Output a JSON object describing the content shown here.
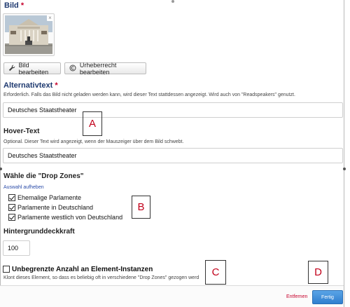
{
  "image_section": {
    "title": "Bild",
    "required_mark": "*",
    "remove_glyph": "×",
    "edit_button": "Bild bearbeiten",
    "copyright_button": "Urheberrecht bearbeiten"
  },
  "alt_text": {
    "title": "Alternativtext",
    "required_mark": "*",
    "help": "Erforderlich. Falls das Bild nicht geladen werden kann, wird dieser Text stattdessen angezeigt. Wird auch von \"Readspeakers\" genutzt.",
    "value": "Deutsches Staatstheater"
  },
  "hover_text": {
    "label": "Hover-Text",
    "help": "Optional. Dieser Text wird angezeigt, wenn der Mauszeiger über dem Bild schwebt.",
    "value": "Deutsches Staatstheater"
  },
  "drop_zones": {
    "label": "Wähle die \"Drop Zones\"",
    "clear_link": "Auswahl aufheben",
    "options": [
      {
        "label": "Ehemalige Parlamente",
        "checked": true
      },
      {
        "label": "Parlamente in Deutschland",
        "checked": true
      },
      {
        "label": "Parlamente westlich von Deutschland",
        "checked": true
      }
    ]
  },
  "opacity": {
    "label": "Hintergrunddeckkraft",
    "value": "100"
  },
  "unlimited": {
    "label": "Unbegrenzte Anzahl an Element-Instanzen",
    "help": "Klont dieses Element, so dass es beliebig oft in verschiedene \"Drop Zones\" gezogen werd",
    "checked": false
  },
  "footer": {
    "remove_label": "Entfernen",
    "done_label": "Fertig"
  },
  "annotations": [
    "A",
    "B",
    "C",
    "D"
  ],
  "colors": {
    "title_blue": "#1f3a70",
    "required_red": "#c6002b",
    "link_blue": "#2a4ba8",
    "primary_button": "#2f7fcf",
    "annotation_red": "#c2001a"
  },
  "icons": {
    "edit_icon": "wrench-icon",
    "copyright_icon": "copyright-icon"
  }
}
